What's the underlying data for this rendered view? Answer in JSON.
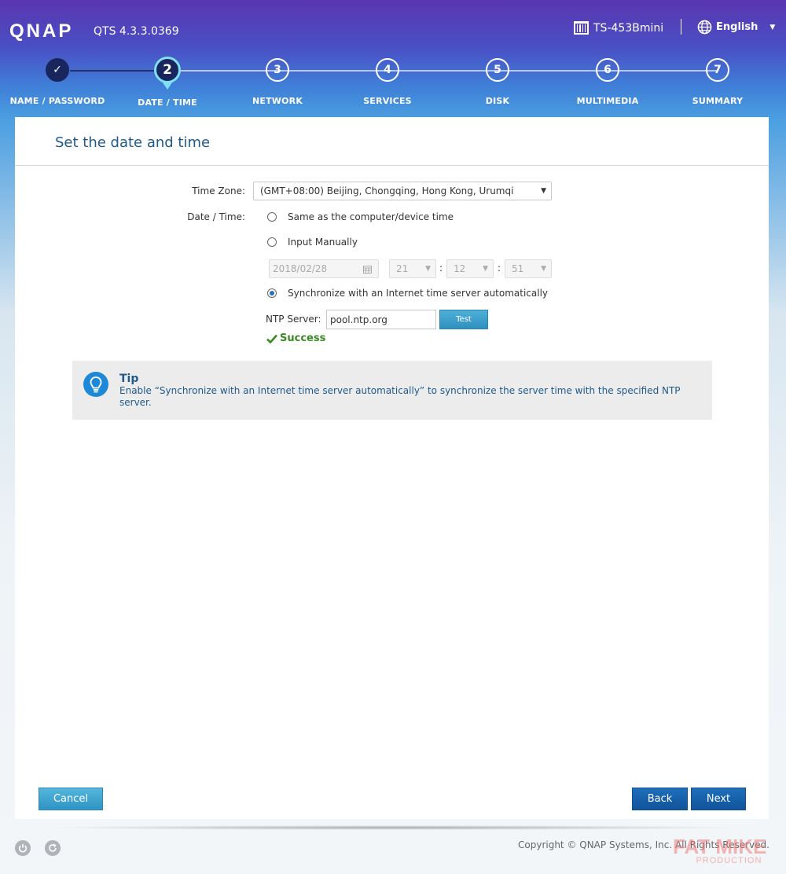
{
  "header": {
    "logo": "QNAP",
    "version": "QTS 4.3.3.0369",
    "device": "TS-453Bmini",
    "language": "English"
  },
  "steps": [
    {
      "number": "✓",
      "label": "NAME / PASSWORD",
      "state": "done"
    },
    {
      "number": "2",
      "label": "DATE / TIME",
      "state": "active"
    },
    {
      "number": "3",
      "label": "NETWORK",
      "state": "todo"
    },
    {
      "number": "4",
      "label": "SERVICES",
      "state": "todo"
    },
    {
      "number": "5",
      "label": "DISK",
      "state": "todo"
    },
    {
      "number": "6",
      "label": "MULTIMEDIA",
      "state": "todo"
    },
    {
      "number": "7",
      "label": "SUMMARY",
      "state": "todo"
    }
  ],
  "panel": {
    "title": "Set the date and time",
    "timezone_label": "Time Zone:",
    "timezone_value": "(GMT+08:00) Beijing, Chongqing, Hong Kong, Urumqi",
    "datetime_label": "Date / Time:",
    "options": {
      "same_as_computer": "Same as the computer/device time",
      "manual": "Input Manually",
      "sync": "Synchronize with an Internet time server automatically"
    },
    "selected_option": "sync",
    "date_value": "2018/02/28",
    "hour": "21",
    "minute": "12",
    "second": "51",
    "colon": ":",
    "ntp_label": "NTP Server:",
    "ntp_value": "pool.ntp.org",
    "test_label": "Test",
    "success_text": "Success"
  },
  "tip": {
    "title": "Tip",
    "text": "Enable “Synchronize with an Internet time server automatically” to synchronize the server time with the specified NTP server."
  },
  "buttons": {
    "cancel": "Cancel",
    "back": "Back",
    "next": "Next"
  },
  "footer": {
    "copyright": "Copyright © QNAP Systems, Inc. All Rights Reserved.",
    "watermark": "FAT MIKE",
    "watermark_sub": "PRODUCTION"
  },
  "colors": {
    "accent": "#1f5a8c",
    "success": "#3a8a24",
    "primary_button": "#11549a"
  }
}
